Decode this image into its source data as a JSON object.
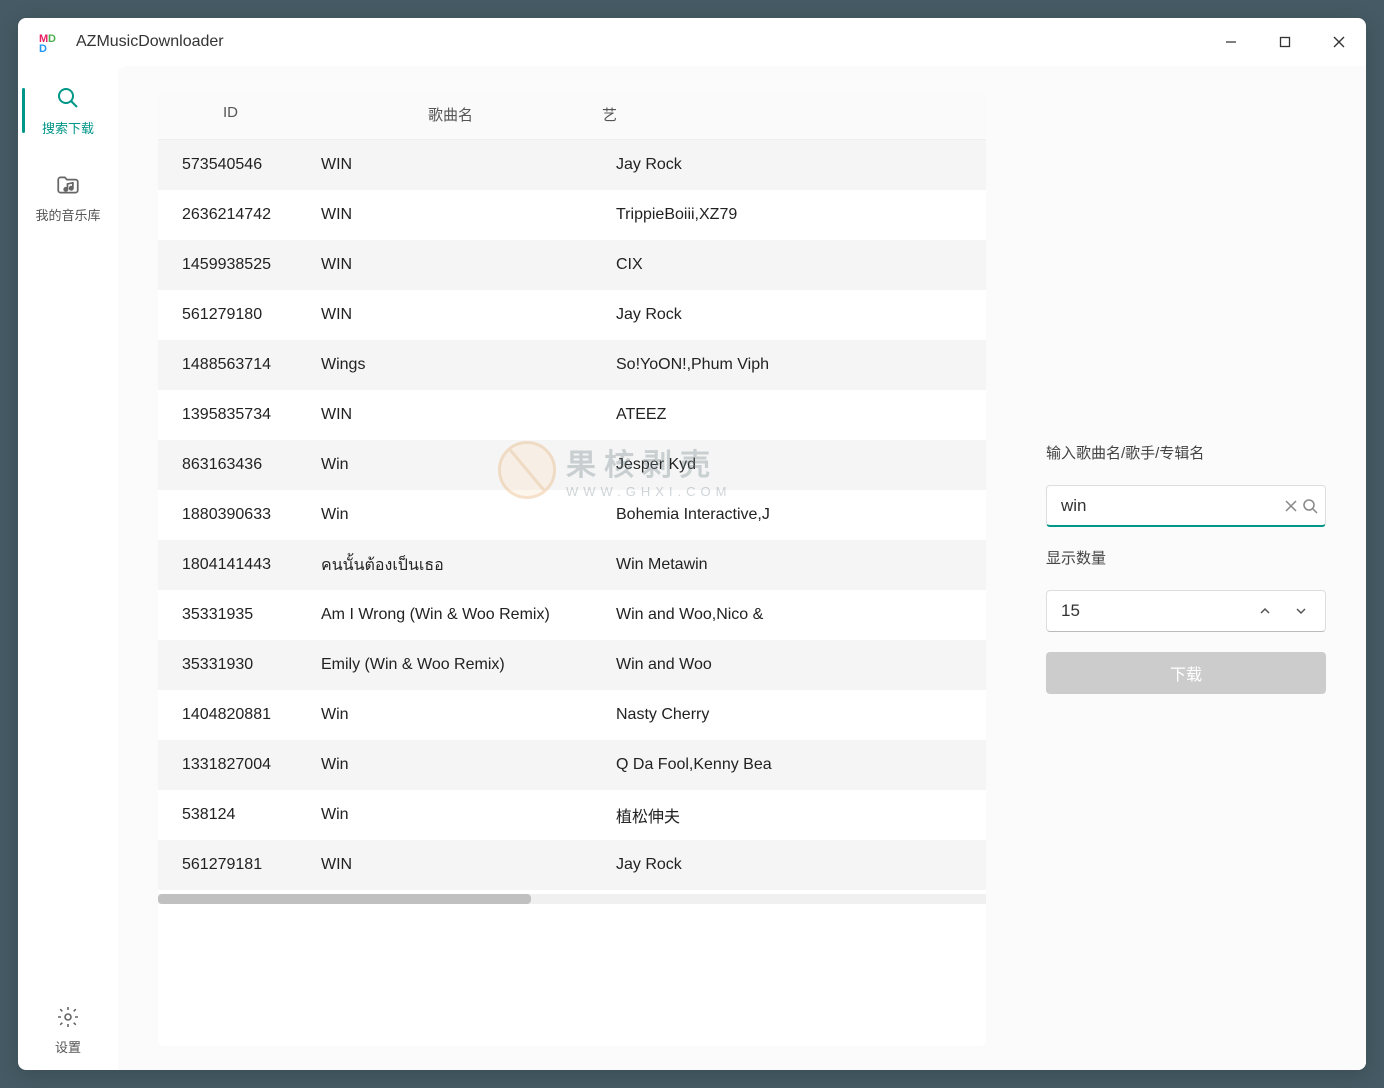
{
  "titlebar": {
    "title": "AZMusicDownloader"
  },
  "sidebar": {
    "items": [
      {
        "label": "搜索下载"
      },
      {
        "label": "我的音乐库"
      }
    ],
    "settings_label": "设置"
  },
  "table": {
    "headers": {
      "id": "ID",
      "name": "歌曲名",
      "artist": "艺"
    },
    "rows": [
      {
        "id": "573540546",
        "name": "WIN",
        "artist": "Jay Rock"
      },
      {
        "id": "2636214742",
        "name": "WIN",
        "artist": "TrippieBoiii,XZ79"
      },
      {
        "id": "1459938525",
        "name": "WIN",
        "artist": "CIX"
      },
      {
        "id": "561279180",
        "name": "WIN",
        "artist": "Jay Rock"
      },
      {
        "id": "1488563714",
        "name": "Wings",
        "artist": "So!YoON!,Phum Viph"
      },
      {
        "id": "1395835734",
        "name": "WIN",
        "artist": "ATEEZ"
      },
      {
        "id": "863163436",
        "name": "Win",
        "artist": "Jesper Kyd"
      },
      {
        "id": "1880390633",
        "name": "Win",
        "artist": "Bohemia Interactive,J"
      },
      {
        "id": "1804141443",
        "name": "คนนั้นต้องเป็นเธอ",
        "artist": "Win Metawin"
      },
      {
        "id": "35331935",
        "name": "Am I Wrong (Win & Woo Remix)",
        "artist": "Win and Woo,Nico &"
      },
      {
        "id": "35331930",
        "name": "Emily (Win & Woo Remix)",
        "artist": "Win and Woo"
      },
      {
        "id": "1404820881",
        "name": "Win",
        "artist": "Nasty Cherry"
      },
      {
        "id": "1331827004",
        "name": "Win",
        "artist": "Q Da Fool,Kenny Bea"
      },
      {
        "id": "538124",
        "name": "Win",
        "artist": "植松伸夫"
      },
      {
        "id": "561279181",
        "name": "WIN",
        "artist": "Jay Rock"
      }
    ]
  },
  "panel": {
    "search_label": "输入歌曲名/歌手/专辑名",
    "search_value": "win",
    "count_label": "显示数量",
    "count_value": "15",
    "download_label": "下载"
  },
  "watermark": {
    "main": "果核剥壳",
    "sub": "WWW.GHXI.COM"
  }
}
